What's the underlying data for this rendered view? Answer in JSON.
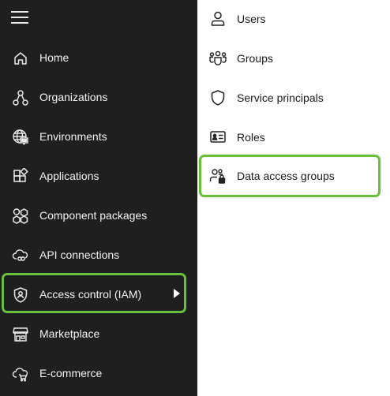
{
  "sidebar": {
    "items": [
      {
        "label": "Home",
        "icon": "home-icon"
      },
      {
        "label": "Organizations",
        "icon": "organizations-icon"
      },
      {
        "label": "Environments",
        "icon": "environments-icon"
      },
      {
        "label": "Applications",
        "icon": "applications-icon"
      },
      {
        "label": "Component packages",
        "icon": "component-packages-icon"
      },
      {
        "label": "API connections",
        "icon": "api-connections-icon"
      },
      {
        "label": "Access control (IAM)",
        "icon": "access-control-icon"
      },
      {
        "label": "Marketplace",
        "icon": "marketplace-icon"
      },
      {
        "label": "E-commerce",
        "icon": "ecommerce-icon"
      }
    ],
    "active_item": "Access control (IAM)"
  },
  "submenu": {
    "items": [
      {
        "label": "Users",
        "icon": "user-icon"
      },
      {
        "label": "Groups",
        "icon": "groups-icon"
      },
      {
        "label": "Service principals",
        "icon": "shield-icon"
      },
      {
        "label": "Roles",
        "icon": "id-card-icon"
      },
      {
        "label": "Data access groups",
        "icon": "data-access-groups-icon"
      }
    ],
    "highlighted_item": "Data access groups"
  },
  "colors": {
    "sidebar_bg": "#1f1f1f",
    "highlight": "#6abf3a",
    "sidebar_text": "#f2f2f2",
    "submenu_bg": "#ffffff"
  }
}
